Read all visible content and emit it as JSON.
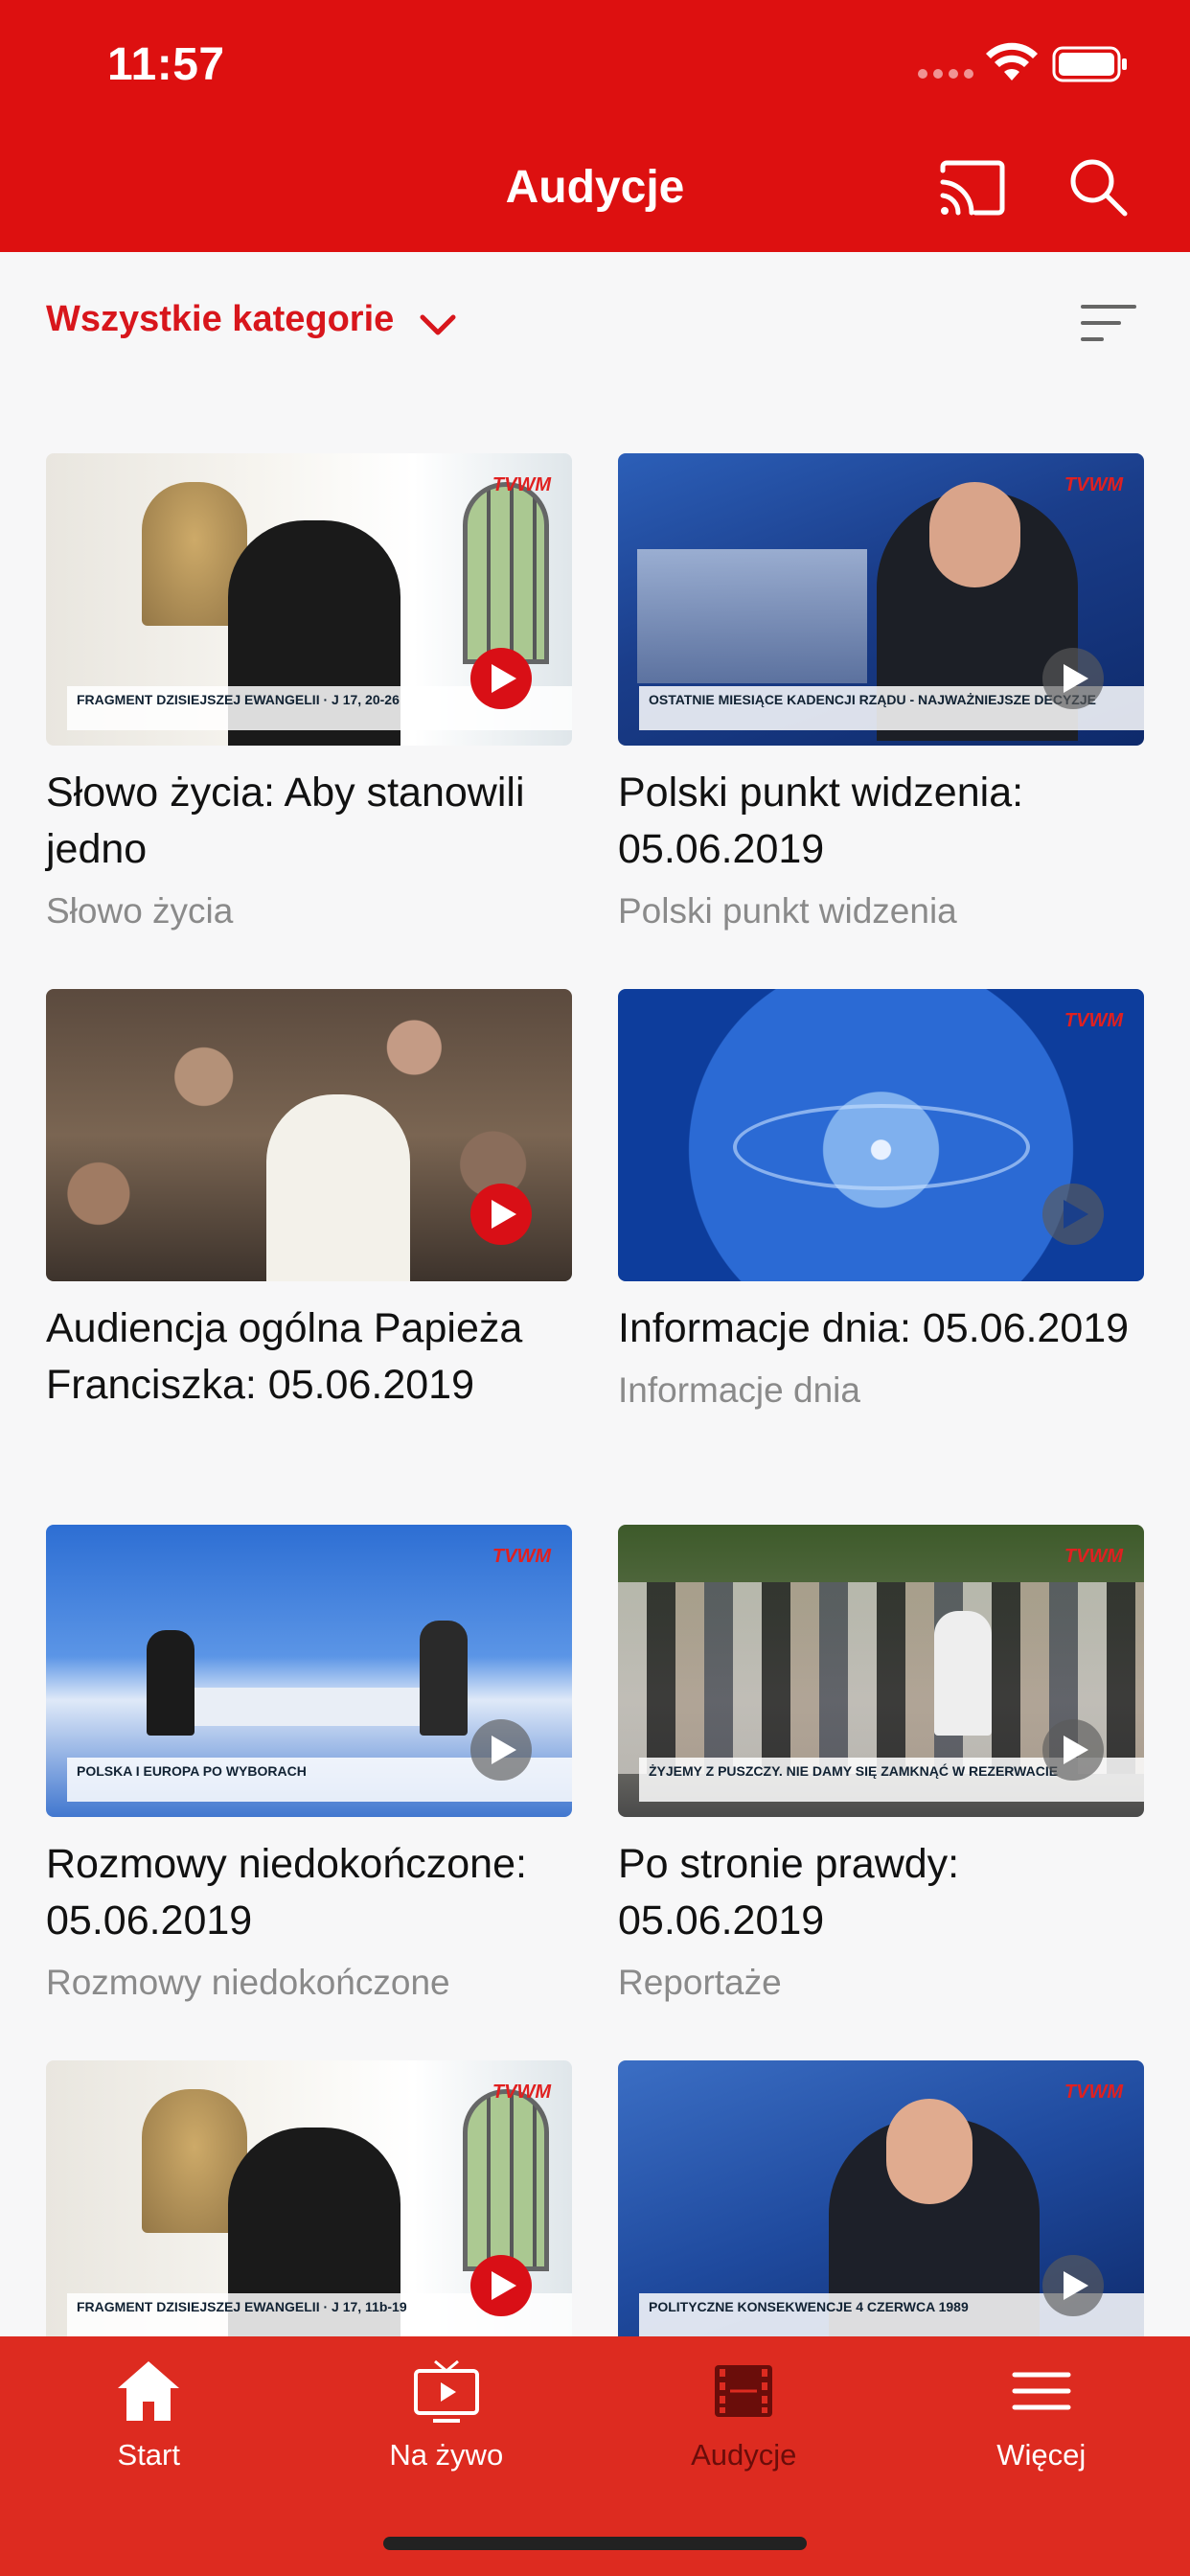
{
  "status_bar": {
    "time": "11:57"
  },
  "header": {
    "title": "Audycje"
  },
  "filter": {
    "label": "Wszystkie kategorie"
  },
  "colors": {
    "brand_red": "#dd1010",
    "tabbar_red": "#dd2b20",
    "active_tab": "#6a0d0a"
  },
  "cards": [
    {
      "title": "Słowo życia: Aby stanowili jedno",
      "subtitle": "Słowo życia",
      "caption": "FRAGMENT DZISIEJSZEJ EWANGELII · J 17, 20-26"
    },
    {
      "title": "Polski punkt widzenia: 05.06.2019",
      "subtitle": "Polski punkt widzenia",
      "caption": "OSTATNIE MIESIĄCE KADENCJI RZĄDU - NAJWAŻNIEJSZE DECYZJE"
    },
    {
      "title": "Audiencja ogólna Papieża Franciszka: 05.06.2019",
      "subtitle": "",
      "caption": ""
    },
    {
      "title": "Informacje dnia: 05.06.2019",
      "subtitle": "Informacje dnia",
      "caption": ""
    },
    {
      "title": "Rozmowy niedokończone: 05.06.2019",
      "subtitle": "Rozmowy niedokończone",
      "caption": "POLSKA I EUROPA PO WYBORACH"
    },
    {
      "title": "Po stronie prawdy: 05.06.2019",
      "subtitle": "Reportaże",
      "caption": "ŻYJEMY Z PUSZCZY. NIE DAMY SIĘ ZAMKNĄĆ W REZERWACIE"
    },
    {
      "title": "",
      "subtitle": "",
      "caption": "FRAGMENT DZISIEJSZEJ EWANGELII · J 17, 11b-19"
    },
    {
      "title": "",
      "subtitle": "",
      "caption": "POLITYCZNE KONSEKWENCJE 4 CZERWCA 1989"
    }
  ],
  "thumb_logo": "TVWM",
  "tabs": [
    {
      "label": "Start",
      "icon": "home-icon"
    },
    {
      "label": "Na żywo",
      "icon": "tv-icon"
    },
    {
      "label": "Audycje",
      "icon": "film-icon"
    },
    {
      "label": "Więcej",
      "icon": "menu-icon"
    }
  ]
}
